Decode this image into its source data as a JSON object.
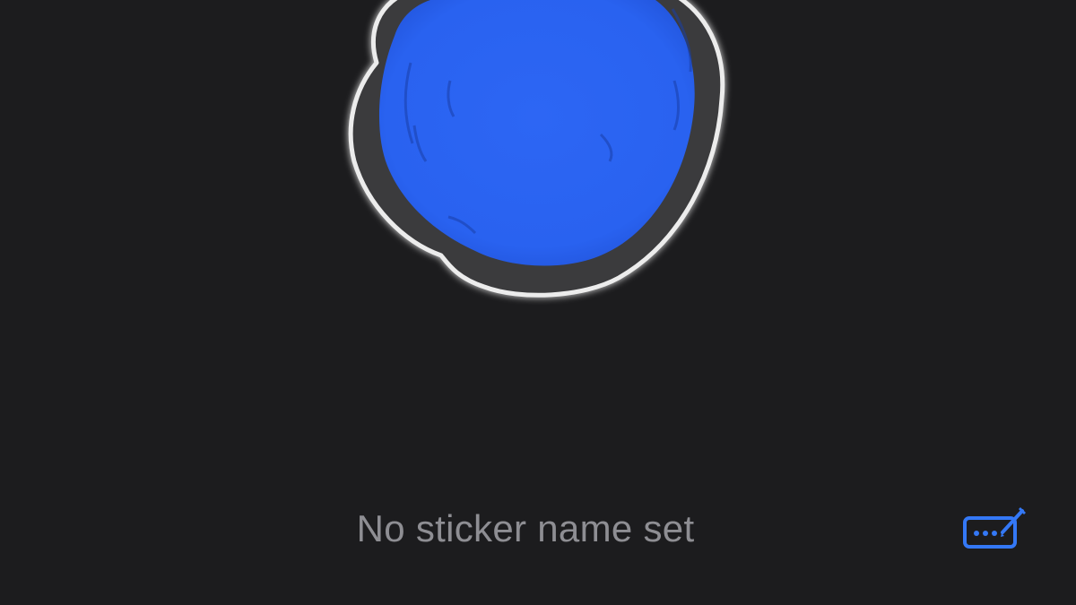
{
  "sticker": {
    "shape": "hand-drawn blue circle",
    "fill_color": "#2962f0",
    "ring_color": "#3a3a3c",
    "outline_color": "#e8e8e8"
  },
  "name_field": {
    "text": "No sticker name set"
  },
  "edit_button": {
    "icon": "keyboard-pencil-icon",
    "color": "#3478f6"
  },
  "theme": {
    "background": "#1c1c1e",
    "secondary_text": "#8e8e93"
  }
}
